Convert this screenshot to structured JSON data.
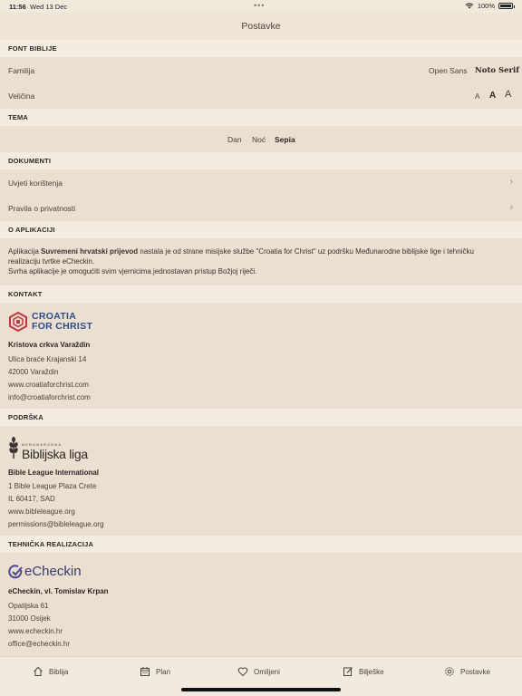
{
  "status": {
    "time": "11:56",
    "date": "Wed 13 Dec",
    "dots": "•••",
    "battery": "100%"
  },
  "nav": {
    "title": "Postavke"
  },
  "font_section": {
    "header": "FONT BIBLIJE",
    "family_label": "Familija",
    "family_options": [
      "Open Sans",
      "Noto Serif"
    ],
    "size_label": "Veličina",
    "size_options": [
      "A",
      "A",
      "A"
    ]
  },
  "theme_section": {
    "header": "TEMA",
    "options": [
      "Dan",
      "Noć",
      "Sepia"
    ],
    "selected": "Sepia"
  },
  "docs_section": {
    "header": "DOKUMENTI",
    "items": [
      "Uvjeti korištenja",
      "Pravila o privatnosti"
    ]
  },
  "about_section": {
    "header": "O APLIKACIJI",
    "text_prefix": "Aplikacija ",
    "text_bold": "Suvremeni hrvatski prijevod",
    "text_rest": " nastala je od strane misijske službe \"Croatia for Christ\" uz podršku Međunarodne biblijske lige i tehničku realizaciju tvrtke eCheckin.",
    "text_line2": "Svrha aplikacije je omogućiti svim vjernicima jednostavan pristup Božjoj riječi."
  },
  "contact_section": {
    "header": "KONTAKT",
    "logo_line1": "CROATIA",
    "logo_line2": "FOR CHRIST",
    "org": "Kristova crkva Varaždin",
    "lines": [
      "Ulica braće Krajanski 14",
      "42000 Varaždin",
      "www.croatiaforchrist.com",
      "info@croatiaforchrist.com"
    ]
  },
  "support_section": {
    "header": "PODRŠKA",
    "logo_small": "MEĐUNARODNA",
    "logo_text": "Biblijska liga",
    "org": "Bible League International",
    "lines": [
      "1 Bible League Plaza Crete",
      "IL 60417, SAD",
      "www.bibleleague.org",
      "permissions@bibleleague.org"
    ]
  },
  "tech_section": {
    "header": "TEHNIČKA REALIZACIJA",
    "logo_text": "eCheckin",
    "org": "eCheckin, vl. Tomislav Krpan",
    "lines": [
      "Opatijska 61",
      "31000 Osijek",
      "www.echeckin.hr",
      "office@echeckin.hr"
    ]
  },
  "tabs": [
    {
      "label": "Biblija",
      "icon": "home-icon"
    },
    {
      "label": "Plan",
      "icon": "calendar-icon"
    },
    {
      "label": "Omiljeni",
      "icon": "heart-icon"
    },
    {
      "label": "Bilješke",
      "icon": "notes-icon"
    },
    {
      "label": "Postavke",
      "icon": "gear-icon"
    }
  ],
  "colors": {
    "background": "#efe4d6",
    "row": "#eadfd0",
    "header": "#f4ece1",
    "accent_red": "#c8323a",
    "accent_blue": "#2b4f8a",
    "echeckin": "#4a4a8a"
  }
}
